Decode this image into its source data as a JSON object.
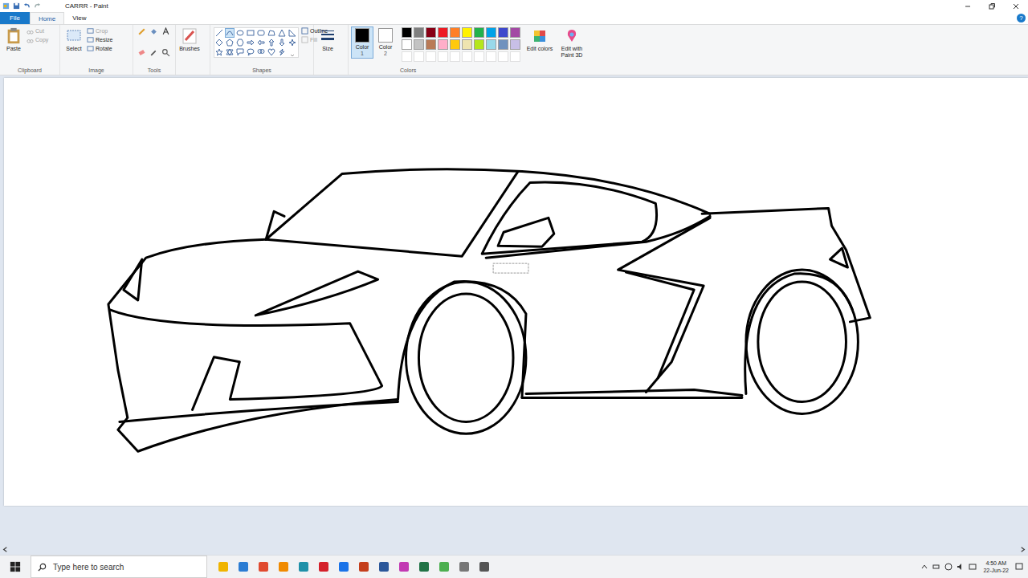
{
  "window": {
    "title": "CARRR - Paint",
    "help": "?"
  },
  "menu_tabs": [
    {
      "label": "File",
      "selected": false
    },
    {
      "label": "Home",
      "selected": true
    },
    {
      "label": "View",
      "selected": false
    }
  ],
  "ribbon": {
    "clipboard": {
      "label": "Clipboard",
      "paste": "Paste",
      "items": [
        {
          "label": "Cut",
          "disabled": true
        },
        {
          "label": "Copy",
          "disabled": true
        }
      ]
    },
    "image": {
      "label": "Image",
      "select": "Select",
      "items": [
        {
          "label": "Crop",
          "disabled": true
        },
        {
          "label": "Resize",
          "disabled": false
        },
        {
          "label": "Rotate",
          "disabled": false
        }
      ]
    },
    "tools": {
      "label": "Tools"
    },
    "brushes": {
      "label": "Brushes"
    },
    "shapes": {
      "label": "Shapes",
      "options": [
        {
          "label": "Outline",
          "disabled": false
        },
        {
          "label": "Fill",
          "disabled": true
        }
      ]
    },
    "size": {
      "label": "Size"
    },
    "color_slots": [
      {
        "label": "Color",
        "number": "1",
        "color": "#000000",
        "selected": true
      },
      {
        "label": "Color",
        "number": "2",
        "color": "#ffffff",
        "selected": false
      }
    ],
    "palette": [
      {
        "color": "#000000"
      },
      {
        "color": "#7f7f7f"
      },
      {
        "color": "#880015"
      },
      {
        "color": "#ed1c24"
      },
      {
        "color": "#ff7f27"
      },
      {
        "color": "#fff200"
      },
      {
        "color": "#22b14c"
      },
      {
        "color": "#00a2e8"
      },
      {
        "color": "#3f48cc"
      },
      {
        "color": "#a349a4"
      },
      {
        "color": "#ffffff"
      },
      {
        "color": "#c3c3c3"
      },
      {
        "color": "#b97a57"
      },
      {
        "color": "#ffaec9"
      },
      {
        "color": "#ffc90e"
      },
      {
        "color": "#efe4b0"
      },
      {
        "color": "#b5e61d"
      },
      {
        "color": "#99d9ea"
      },
      {
        "color": "#7092be"
      },
      {
        "color": "#c8bfe7"
      }
    ],
    "colors_label": "Colors",
    "edit_colors": "Edit colors",
    "paint3d": "Edit with Paint 3D"
  },
  "taskbar": {
    "search_placeholder": "Type here to search",
    "time": "4:50 AM",
    "date": "22-Jun-22"
  }
}
